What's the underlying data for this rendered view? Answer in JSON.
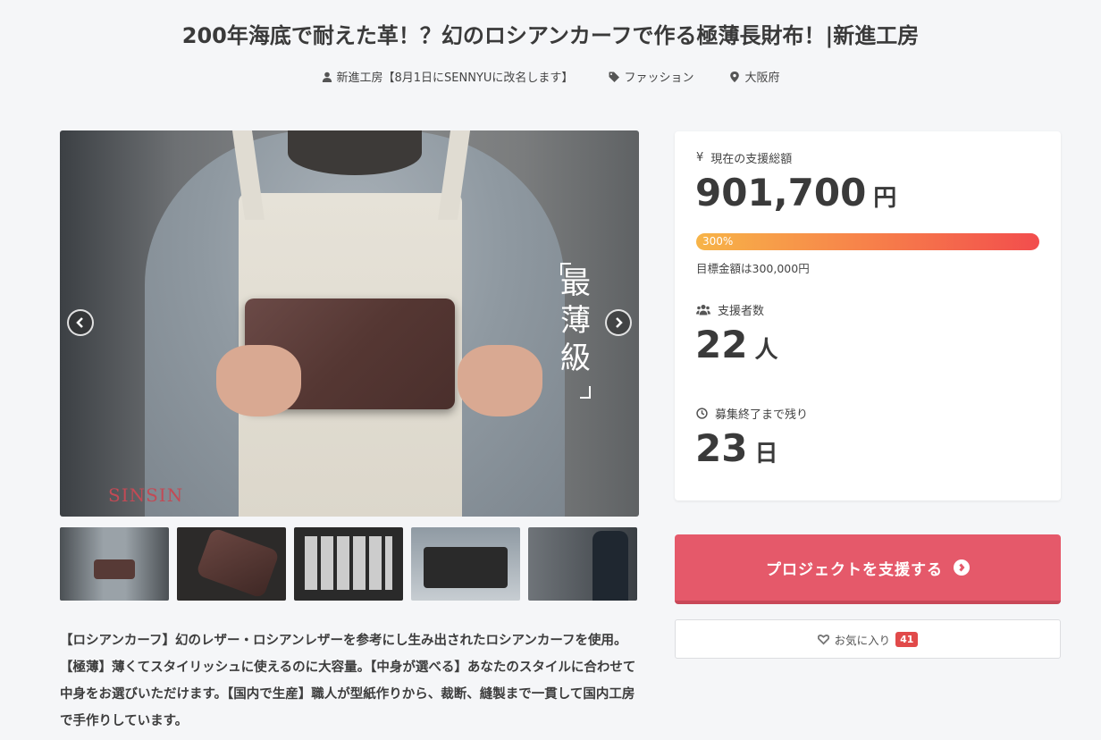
{
  "project": {
    "title": "200年海底で耐えた革！？幻のロシアンカーフで作る極薄長財布！|新進工房",
    "owner": "新進工房【8月1日にSENNYUに改名します】",
    "category": "ファッション",
    "location": "大阪府"
  },
  "hero": {
    "overlay_text": [
      "最",
      "薄",
      "級"
    ],
    "brand_mark": "SINSIN"
  },
  "thumbnails": [
    "thumb-1",
    "thumb-2",
    "thumb-3",
    "thumb-4",
    "thumb-5"
  ],
  "description": "【ロシアンカーフ】幻のレザー・ロシアンレザーを参考にし生み出されたロシアンカーフを使用。【極薄】薄くてスタイリッシュに使えるのに大容量。【中身が選べる】あなたのスタイルに合わせて中身をお選びいただけます。【国内で生産】職人が型紙作りから、裁断、縫製まで一貫して国内工房で手作りしています。",
  "stats": {
    "funding_label": "現在の支援総額",
    "funding_amount": "901,700",
    "funding_unit": "円",
    "progress_label": "300%",
    "progress_percent": 300,
    "goal_text": "目標金額は300,000円",
    "backers_label": "支援者数",
    "backers_count": "22",
    "backers_unit": "人",
    "remaining_label": "募集終了まで残り",
    "remaining_count": "23",
    "remaining_unit": "日"
  },
  "actions": {
    "support_label": "プロジェクトを支援する",
    "favorite_label": "お気に入り",
    "favorite_count": "41"
  },
  "colors": {
    "support_button": "#e5596a",
    "progress_start": "#f7b448",
    "progress_end": "#f24d4d",
    "badge": "#e14a4a"
  }
}
